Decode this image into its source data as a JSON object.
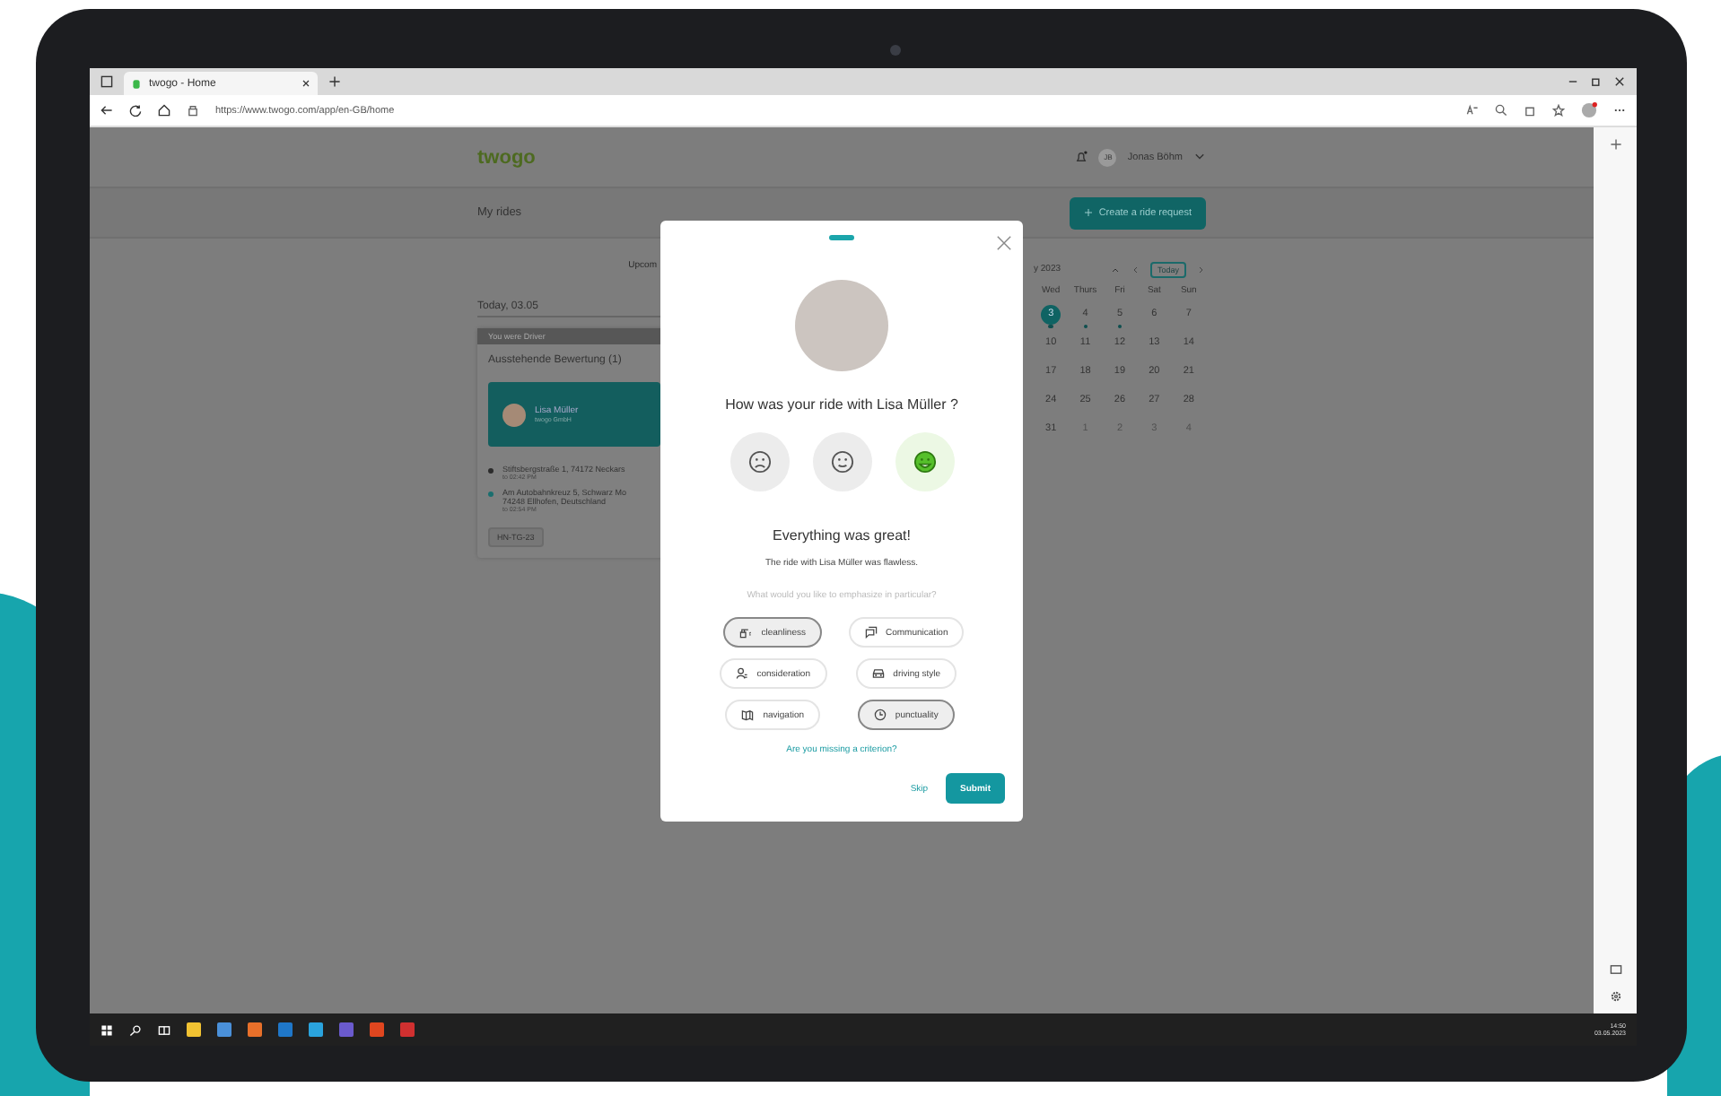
{
  "browser": {
    "tab_title": "twogo - Home",
    "url": "https://www.twogo.com/app/en-GB/home"
  },
  "header": {
    "logo": "twogo",
    "user_initials": "JB",
    "user_name": "Jonas Böhm"
  },
  "subheader": {
    "title": "My rides",
    "create_button": "Create a ride request"
  },
  "rides": {
    "tab_partial": "Upcom",
    "date": "Today, 03.05",
    "card": {
      "role": "You were Driver",
      "pending": "Ausstehende Bewertung (1)",
      "person_name": "Lisa Müller",
      "company": "twogo GmbH",
      "stops": [
        {
          "address": "Stiftsbergstraße 1, 74172 Neckars",
          "time": "to 02:42 PM",
          "color": "#2b2b2b"
        },
        {
          "address": "Am Autobahnkreuz 5, Schwarz Mo\n74248 Ellhofen, Deutschland",
          "time": "to 02:54 PM",
          "color": "#1a6e6e"
        }
      ],
      "plate": "HN-TG-23"
    }
  },
  "calendar": {
    "month_partial": "y 2023",
    "today_button": "Today",
    "weekdays": [
      "Wed",
      "Thurs",
      "Fri",
      "Sat",
      "Sun"
    ],
    "days": [
      {
        "label": "3",
        "selected": true,
        "dot": true,
        "muted": false
      },
      {
        "label": "4",
        "selected": false,
        "dot": true,
        "muted": false
      },
      {
        "label": "5",
        "selected": false,
        "dot": true,
        "muted": false
      },
      {
        "label": "6",
        "selected": false,
        "dot": false,
        "muted": false
      },
      {
        "label": "7",
        "selected": false,
        "dot": false,
        "muted": false
      },
      {
        "label": "10",
        "selected": false,
        "dot": false,
        "muted": false
      },
      {
        "label": "11",
        "selected": false,
        "dot": false,
        "muted": false
      },
      {
        "label": "12",
        "selected": false,
        "dot": false,
        "muted": false
      },
      {
        "label": "13",
        "selected": false,
        "dot": false,
        "muted": false
      },
      {
        "label": "14",
        "selected": false,
        "dot": false,
        "muted": false
      },
      {
        "label": "17",
        "selected": false,
        "dot": false,
        "muted": false
      },
      {
        "label": "18",
        "selected": false,
        "dot": false,
        "muted": false
      },
      {
        "label": "19",
        "selected": false,
        "dot": false,
        "muted": false
      },
      {
        "label": "20",
        "selected": false,
        "dot": false,
        "muted": false
      },
      {
        "label": "21",
        "selected": false,
        "dot": false,
        "muted": false
      },
      {
        "label": "24",
        "selected": false,
        "dot": false,
        "muted": false
      },
      {
        "label": "25",
        "selected": false,
        "dot": false,
        "muted": false
      },
      {
        "label": "26",
        "selected": false,
        "dot": false,
        "muted": false
      },
      {
        "label": "27",
        "selected": false,
        "dot": false,
        "muted": false
      },
      {
        "label": "28",
        "selected": false,
        "dot": false,
        "muted": false
      },
      {
        "label": "31",
        "selected": false,
        "dot": false,
        "muted": false
      },
      {
        "label": "1",
        "selected": false,
        "dot": false,
        "muted": true
      },
      {
        "label": "2",
        "selected": false,
        "dot": false,
        "muted": true
      },
      {
        "label": "3",
        "selected": false,
        "dot": false,
        "muted": true
      },
      {
        "label": "4",
        "selected": false,
        "dot": false,
        "muted": true
      }
    ]
  },
  "modal": {
    "title": "How was your ride with Lisa Müller ?",
    "reactions": [
      {
        "kind": "sad",
        "selected": false
      },
      {
        "kind": "neutral",
        "selected": false
      },
      {
        "kind": "happy",
        "selected": true
      }
    ],
    "result_title": "Everything was great!",
    "result_text": "The ride with Lisa Müller was flawless.",
    "prompt": "What would you like to emphasize in particular?",
    "criteria": [
      {
        "label": "cleanliness",
        "kind": "spray",
        "selected": true
      },
      {
        "label": "Communication",
        "kind": "chat",
        "selected": false
      },
      {
        "label": "consideration",
        "kind": "person",
        "selected": false
      },
      {
        "label": "driving style",
        "kind": "car",
        "selected": false
      },
      {
        "label": "navigation",
        "kind": "map",
        "selected": false
      },
      {
        "label": "punctuality",
        "kind": "clock",
        "selected": true
      }
    ],
    "missing_link": "Are you missing a criterion?",
    "skip": "Skip",
    "submit": "Submit"
  },
  "taskbar": {
    "time": "14:50",
    "date": "03.05.2023"
  }
}
